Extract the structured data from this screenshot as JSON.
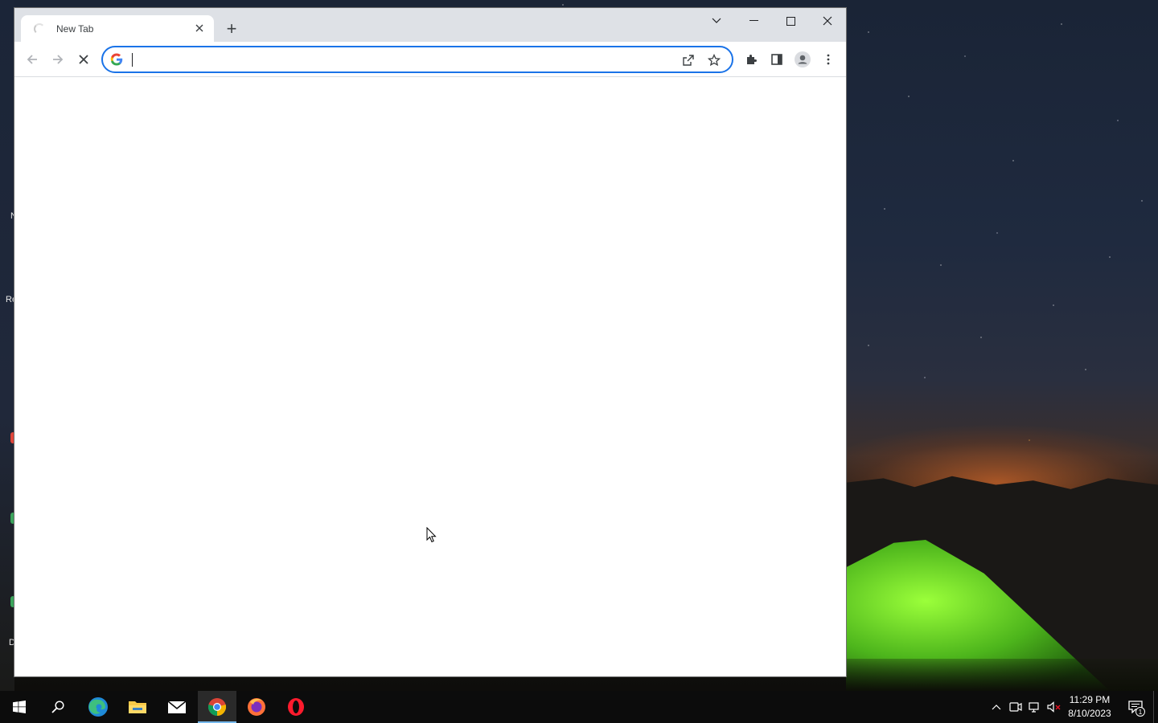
{
  "browser": {
    "tab": {
      "title": "New Tab",
      "loading": true
    },
    "new_tab_symbol": "+",
    "omnibox": {
      "value": "",
      "placeholder": "",
      "focused": true
    },
    "accent_color": "#1a73e8"
  },
  "taskbar": {
    "apps": [
      "start-icon",
      "search-icon",
      "edge-icon",
      "file-explorer-icon",
      "mail-icon",
      "chrome-icon",
      "firefox-icon",
      "opera-icon"
    ],
    "active_app": "chrome-icon",
    "clock": {
      "time": "11:29 PM",
      "date": "8/10/2023"
    },
    "notification_count": "1"
  },
  "desktop": {
    "fragments": [
      "N",
      "Re",
      "D"
    ]
  }
}
